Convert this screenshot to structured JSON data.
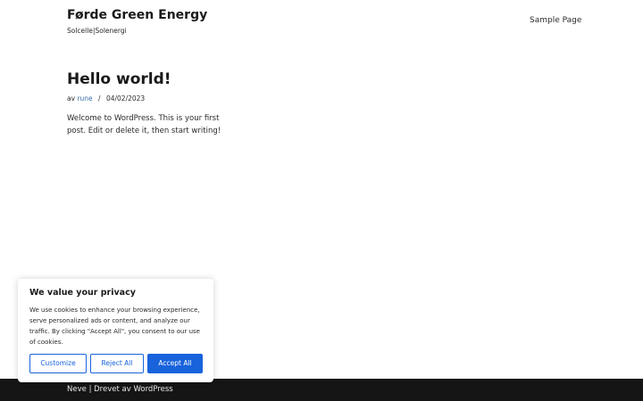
{
  "header": {
    "site_title": "Førde Green Energy",
    "tagline": "Solcelle|Solenergi",
    "nav": [
      {
        "label": "Sample Page"
      }
    ]
  },
  "post": {
    "title": "Hello world!",
    "meta_prefix": "av",
    "author": "rune",
    "separator": "/",
    "date": "04/02/2023",
    "excerpt": "Welcome to WordPress. This is your first post. Edit or delete it, then start writing!"
  },
  "cookie_banner": {
    "title": "We value your privacy",
    "text": "We use cookies to enhance your browsing experience, serve personalized ads or content, and analyze our traffic. By clicking \"Accept All\", you consent to our use of cookies.",
    "customize_label": "Customize",
    "reject_label": "Reject All",
    "accept_label": "Accept All",
    "accent_color": "#1863dc"
  },
  "footer": {
    "theme_link": "Neve",
    "separator": "|",
    "powered_prefix": "Drevet av",
    "powered_link": "WordPress"
  }
}
